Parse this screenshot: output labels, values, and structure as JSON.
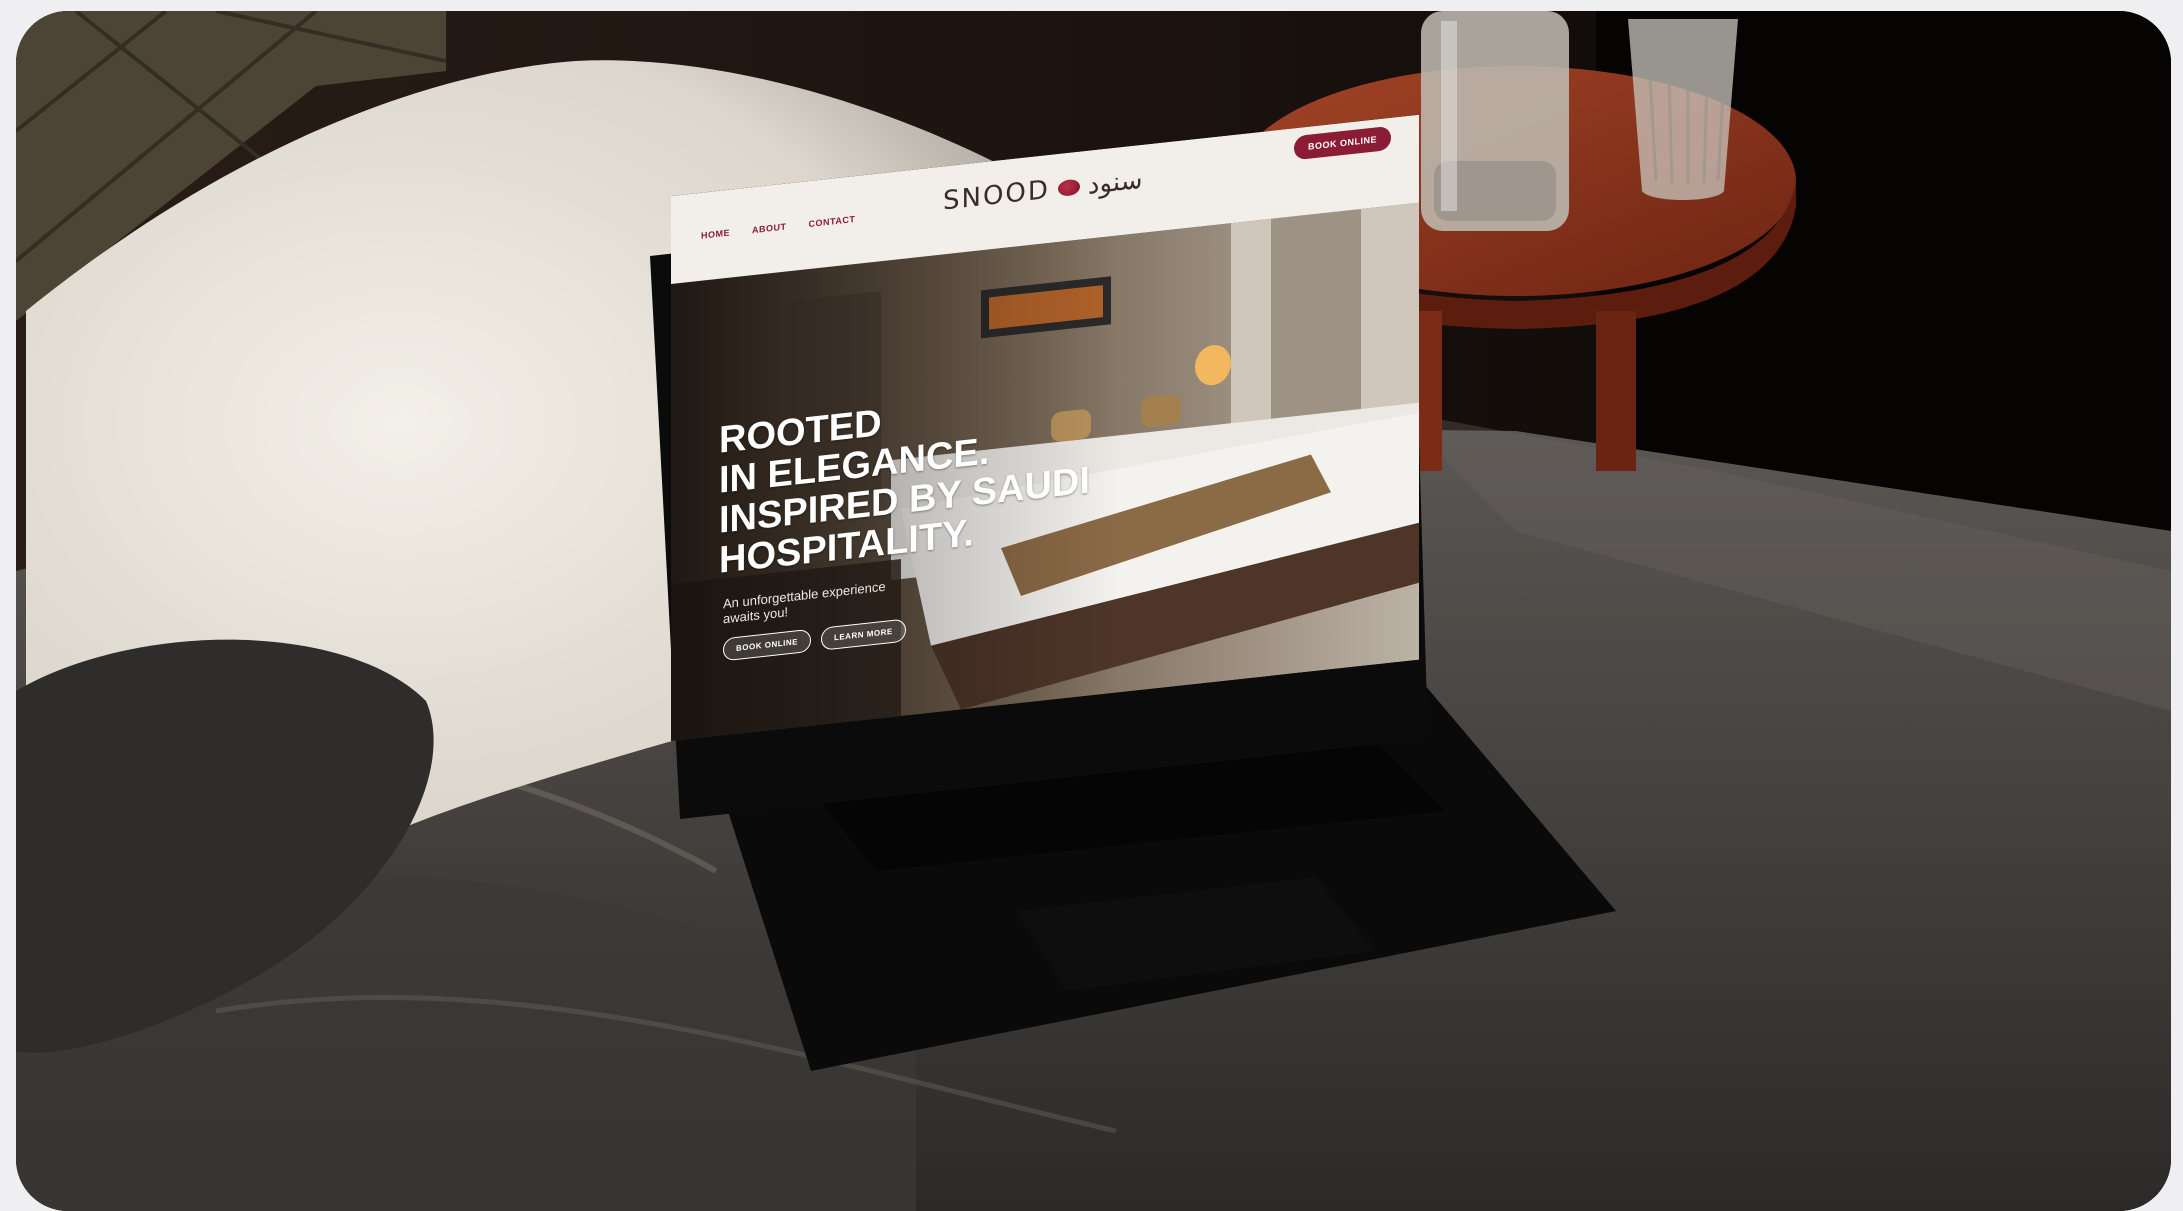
{
  "website": {
    "nav": [
      "HOME",
      "ABOUT",
      "CONTACT"
    ],
    "brand": {
      "latin": "SNOOD",
      "arabic": "سنود"
    },
    "book_button": "BOOK ONLINE",
    "hero": {
      "title_lines": [
        "ROOTED",
        "IN ELEGANCE.",
        "INSPIRED BY SAUDI",
        "HOSPITALITY."
      ],
      "subtitle": "An unforgettable experience awaits you!",
      "buttons": [
        "BOOK ONLINE",
        "LEARN MORE"
      ]
    }
  },
  "colors": {
    "brand_accent": "#8b1c36",
    "header_bg": "#f2eee9",
    "pillow": "#e9e5dd",
    "duvet": "#4a4642",
    "laptop_body": "#090909",
    "side_table": "#8a3118"
  },
  "objects": [
    "headboard",
    "pillow",
    "duvet",
    "laptop",
    "side-table",
    "water-bottle",
    "drinking-glass"
  ]
}
